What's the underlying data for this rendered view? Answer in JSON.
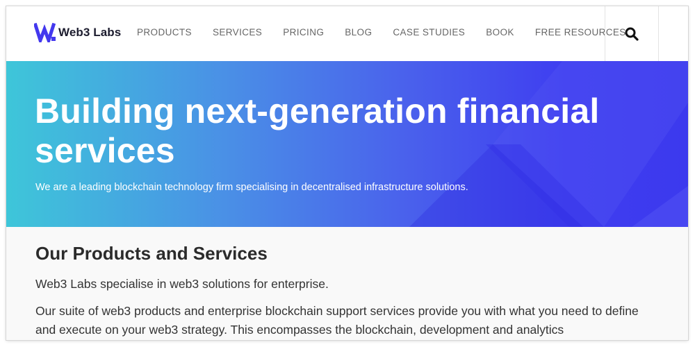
{
  "header": {
    "brand": "Web3 Labs",
    "nav": [
      {
        "label": "PRODUCTS"
      },
      {
        "label": "SERVICES"
      },
      {
        "label": "PRICING"
      },
      {
        "label": "BLOG"
      },
      {
        "label": "CASE STUDIES"
      },
      {
        "label": "BOOK"
      },
      {
        "label": "FREE RESOURCES"
      }
    ],
    "search_icon": "search-icon"
  },
  "hero": {
    "title": "Building next-generation financial services",
    "subtitle": "We are a leading blockchain technology firm specialising in decentralised infrastructure solutions."
  },
  "content": {
    "heading": "Our Products and Services",
    "paragraph1": "Web3 Labs specialise in web3 solutions for enterprise.",
    "paragraph2": "Our suite of web3 products and enterprise blockchain support services provide you with what you need to define and execute on your web3 strategy. This encompasses the blockchain, development and analytics"
  },
  "colors": {
    "brand": "#4338ee",
    "hero_gradient_start": "#3ec6d9",
    "hero_gradient_end": "#3c39ee",
    "nav_text": "#666666",
    "content_bg": "#f9f9f9"
  }
}
